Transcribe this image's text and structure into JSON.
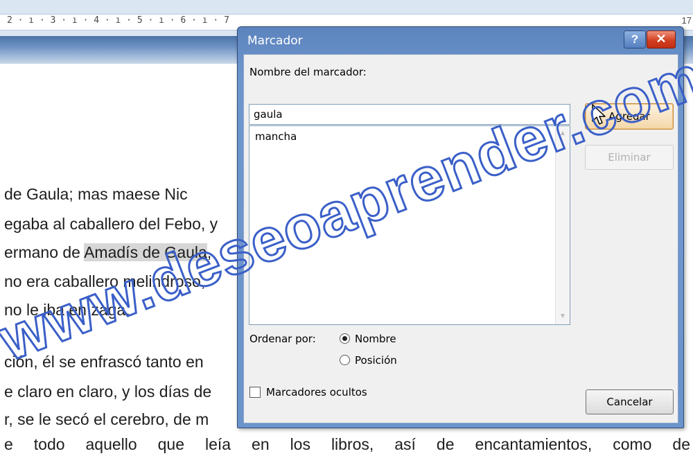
{
  "ruler": {
    "marks": "2 · ı · 3 · ı · 4 · ı · 5 · ı · 6 · ı · 7",
    "end_mark": "17"
  },
  "document": {
    "line1": "de Gaula; mas maese Nic",
    "line2": "egaba al caballero del Febo, y",
    "line3_pre": "ermano de ",
    "line3_highlight": "Amadís de Gaula",
    "line3_post": ",",
    "line4": "no era caballero melindroso,",
    "line5": "no le iba en zaga.",
    "line6": "ción, él se enfrascó tanto en",
    "line7": "e claro en claro, y los días de",
    "line8": "r, se le secó el cerebro, de m",
    "line9": "e todo aquello que leía en los libros, así de encantamientos, como de",
    "highlight_color": "#d6d6d6"
  },
  "watermark": {
    "text": "www.deseoaprender.com",
    "color": "#3a5fc8"
  },
  "dialog": {
    "title": "Marcador",
    "help_label": "?",
    "close_label": "✕",
    "name_label": "Nombre del marcador:",
    "name_value": "gaula",
    "list_items": [
      "mancha"
    ],
    "add_label": "Agregar",
    "delete_label": "Eliminar",
    "sort_label": "Ordenar por:",
    "sort_options": [
      "Nombre",
      "Posición"
    ],
    "sort_selected": "Nombre",
    "hidden_label": "Marcadores ocultos",
    "hidden_checked": false,
    "cancel_label": "Cancelar",
    "title_bar_color": "#5b83bd",
    "close_color": "#d03c1e"
  },
  "icons": {
    "scroll_up": "scroll-up-icon",
    "scroll_down": "scroll-down-icon",
    "cursor": "mouse-cursor-icon"
  }
}
